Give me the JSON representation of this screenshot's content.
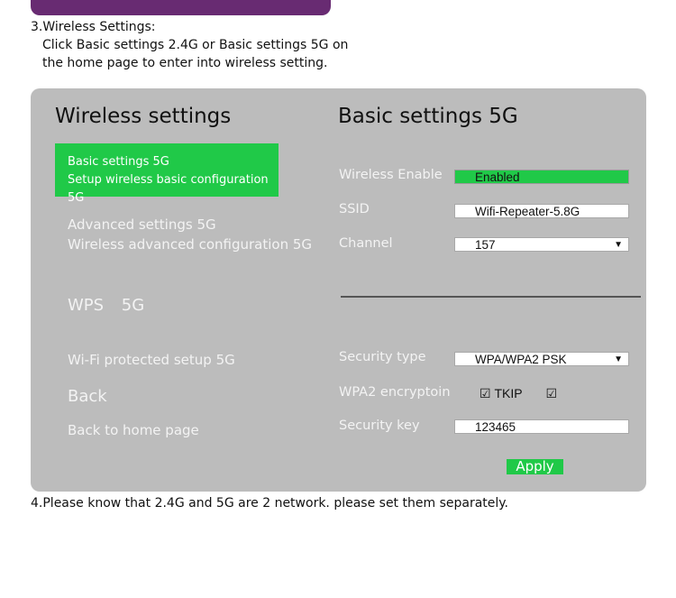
{
  "instructions": {
    "step3_title": "3.Wireless Settings:",
    "step3_line1": "Click Basic settings 2.4G or Basic settings 5G on",
    "step3_line2": "the home page to enter into wireless setting.",
    "step4": "4.Please know that 2.4G and 5G are 2 network. please set them separately."
  },
  "left": {
    "heading": "Wireless settings",
    "basic": {
      "title": "Basic settings 5G",
      "subtitle": "Setup wireless basic configuration 5G"
    },
    "advanced": {
      "title": "Advanced settings 5G",
      "subtitle": "Wireless advanced configuration 5G"
    },
    "wps": {
      "title": "WPS  5G",
      "subtitle": "Wi-Fi protected setup 5G"
    },
    "back": {
      "title": "Back",
      "subtitle": "Back to home page"
    }
  },
  "right": {
    "heading": "Basic settings 5G",
    "wireless_enable": {
      "label": "Wireless Enable",
      "value": "Enabled"
    },
    "ssid": {
      "label": "SSID",
      "value": "Wifi-Repeater-5.8G"
    },
    "channel": {
      "label": "Channel",
      "value": "157"
    },
    "security_type": {
      "label": "Security type",
      "value": "WPA/WPA2 PSK"
    },
    "encryption": {
      "label": "WPA2 encryptoin",
      "option1": "TKIP",
      "option1_checked": true,
      "option2": "",
      "option2_checked": true
    },
    "security_key": {
      "label": "Security key",
      "value": "123465"
    },
    "apply_label": "Apply"
  },
  "icons": {
    "dropdown": "▼",
    "checkbox_checked": "☑"
  },
  "colors": {
    "accent_green": "#20c948",
    "panel_bg": "#bcbcbc",
    "header_purple": "#682b72"
  }
}
